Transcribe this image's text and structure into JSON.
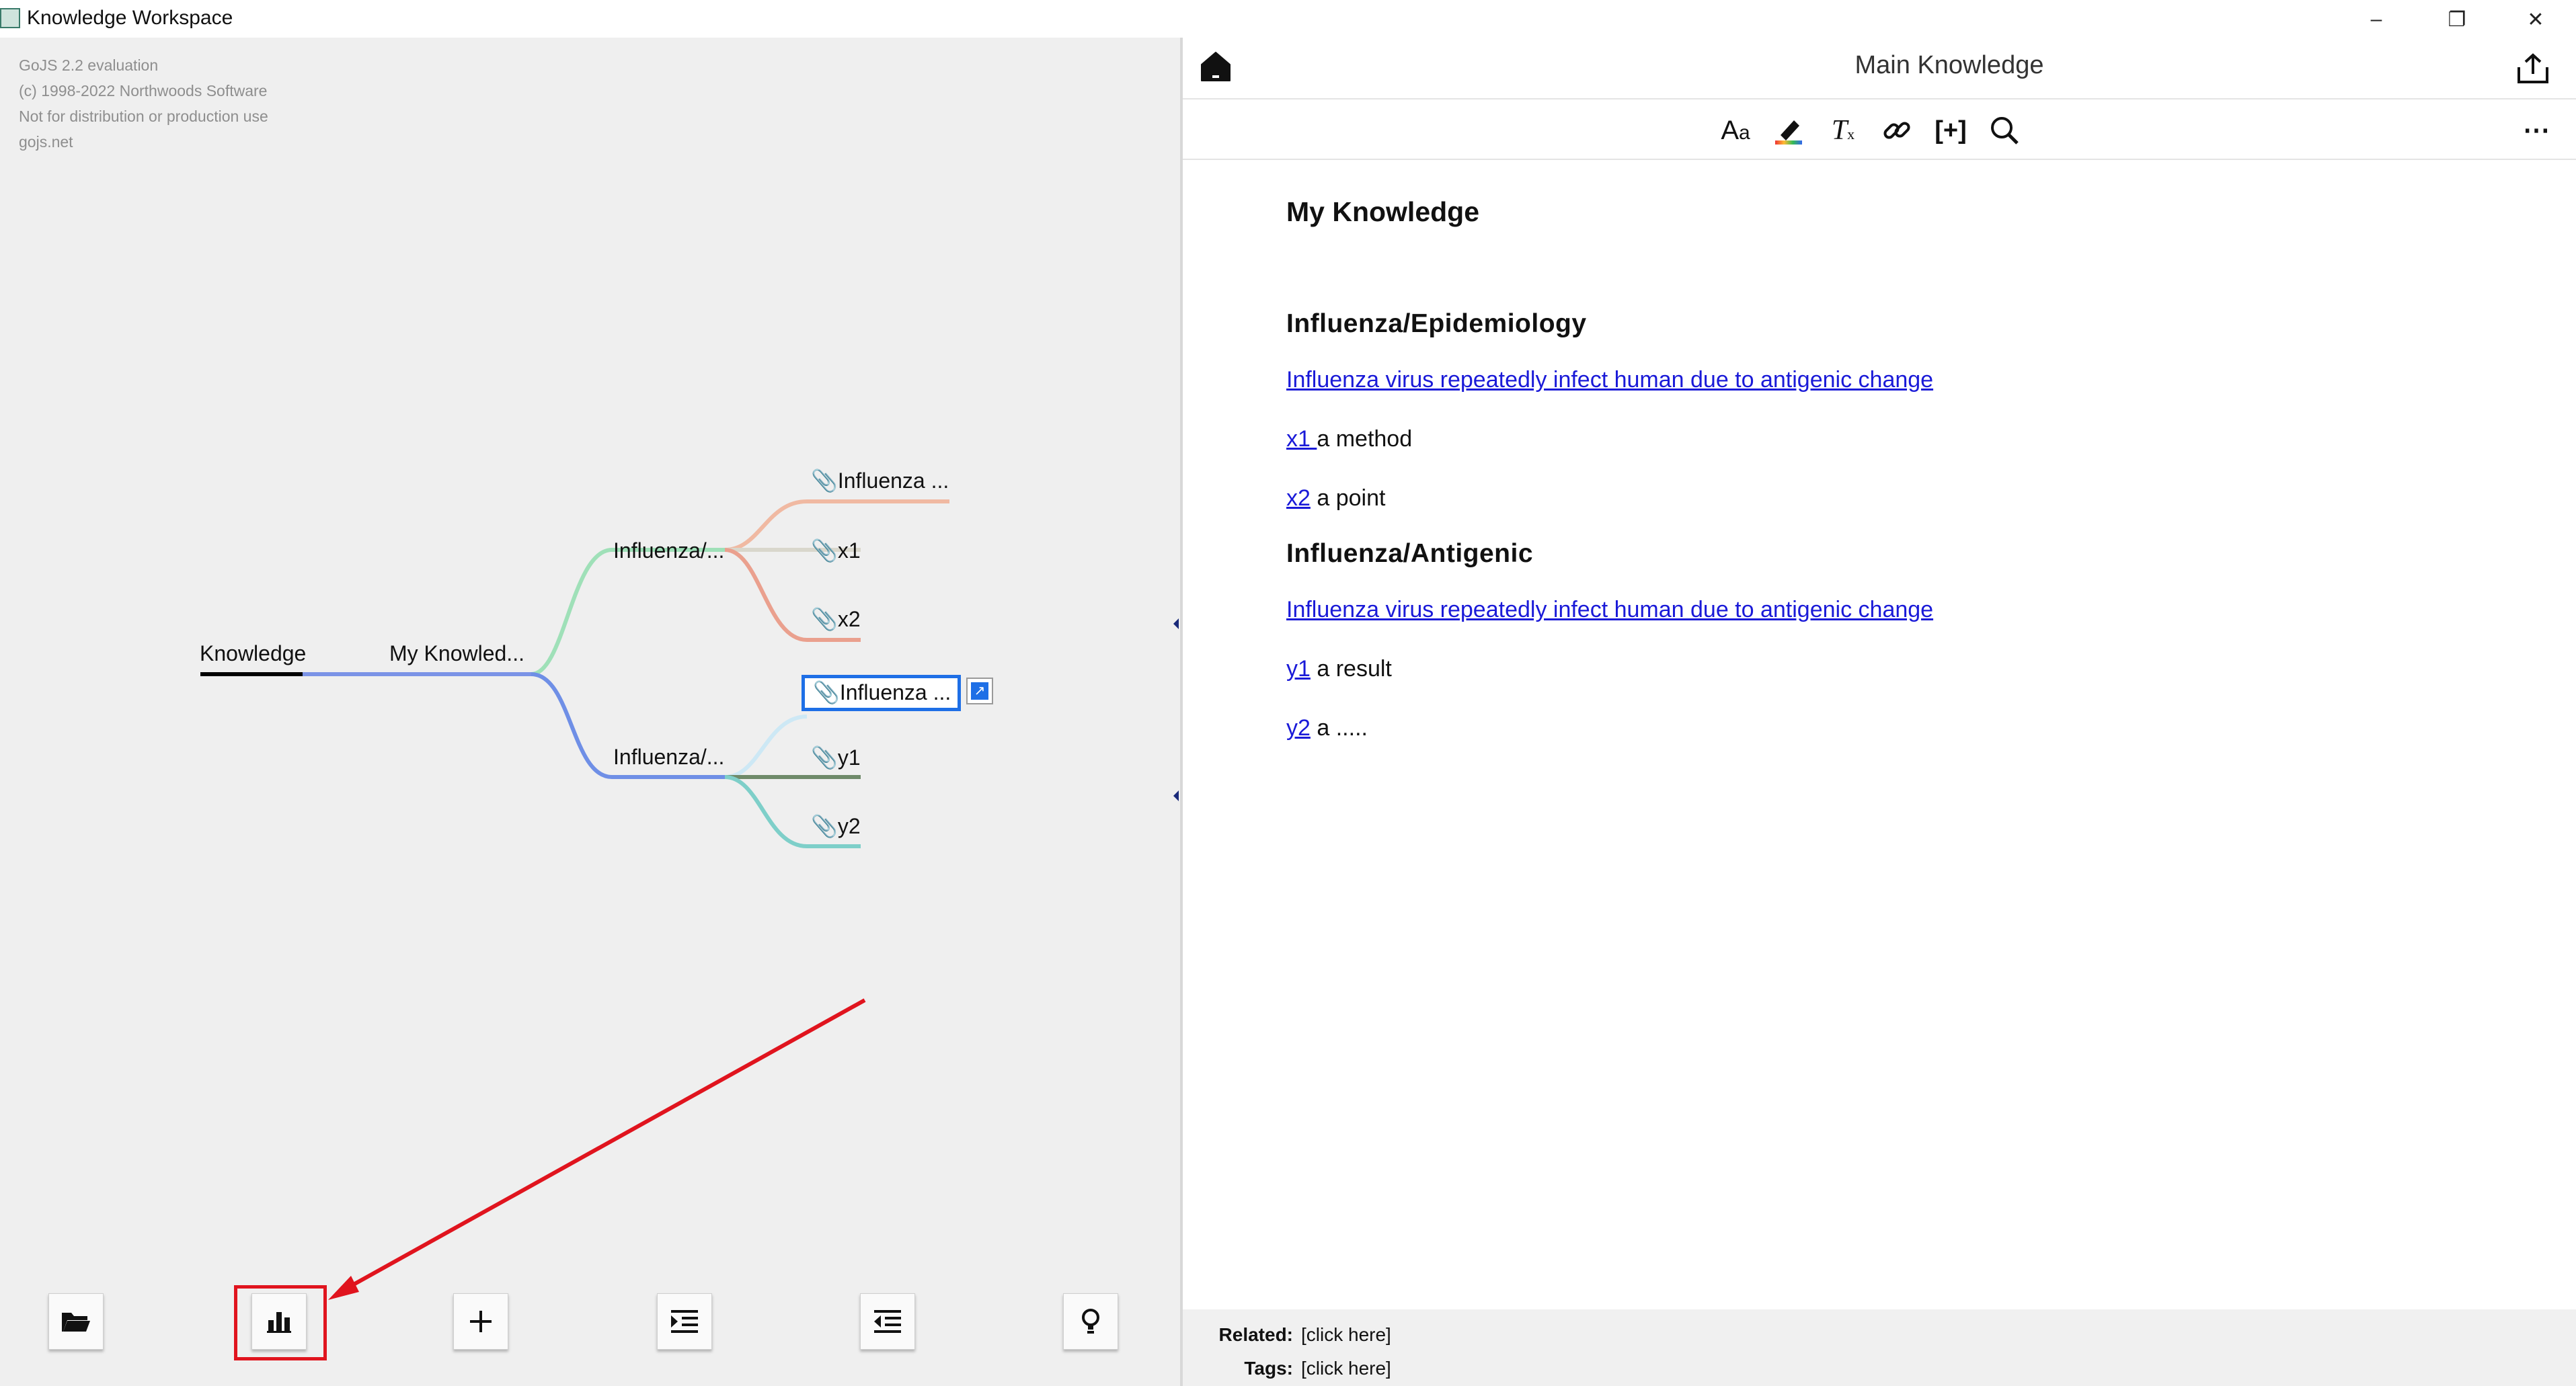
{
  "window": {
    "title": "Knowledge Workspace",
    "controls": {
      "minimize": "–",
      "maximize": "❐",
      "close": "✕"
    }
  },
  "watermark": {
    "line1": "GoJS 2.2 evaluation",
    "line2": "(c) 1998-2022 Northwoods Software",
    "line3": "Not for distribution or production use",
    "line4": "gojs.net"
  },
  "mindmap": {
    "root": "Knowledge",
    "level1": "My Knowled...",
    "branch_epidemiology": "Influenza/...",
    "branch_antigenic": "Influenza/...",
    "leaf_e1": "Influenza ...",
    "leaf_x1": "x1",
    "leaf_x2": "x2",
    "leaf_a1": "Influenza ...",
    "leaf_y1": "y1",
    "leaf_y2": "y2",
    "link_colors": {
      "root": "#7b93e6",
      "upper": "#9fe0b8",
      "lower": "#6f8fe6",
      "e1": "#f0b9a2",
      "x1": "#d9d7cc",
      "x2": "#eaa08e",
      "a1": "#cde8f5",
      "y1": "#6f8a6a",
      "y2": "#7ecfc9"
    }
  },
  "bottom_toolbar": {
    "open": "folder-open-icon",
    "chart": "bar-chart-icon",
    "add": "plus-icon",
    "indent": "indent-icon",
    "outdent": "outdent-icon",
    "idea": "lightbulb-icon"
  },
  "editor": {
    "title": "Main Knowledge",
    "toolbar": [
      "font-size-icon",
      "highlighter-icon",
      "clear-format-icon",
      "link-icon",
      "insert-bracket-icon",
      "search-icon",
      "more-icon"
    ],
    "heading": "My Knowledge",
    "section1": {
      "title": "Influenza/Epidemiology",
      "link": "Influenza virus repeatedly infect human due to antigenic change",
      "item1_link": "x1 ",
      "item1_text": "a method",
      "item2_link": "x2",
      "item2_text": " a point"
    },
    "section2": {
      "title": "Influenza/Antigenic",
      "link": "Influenza virus repeatedly infect human due to antigenic change",
      "item1_link": "y1",
      "item1_text": " a result",
      "item2_link": "y2",
      "item2_text": " a ....."
    },
    "footer": {
      "related_label": "Related:",
      "related_value": "[click here]",
      "tags_label": "Tags:",
      "tags_value": "[click here]"
    }
  },
  "colors": {
    "link": "#1a1ad8",
    "highlight": "#e0141e",
    "selection": "#1e6fe6"
  }
}
